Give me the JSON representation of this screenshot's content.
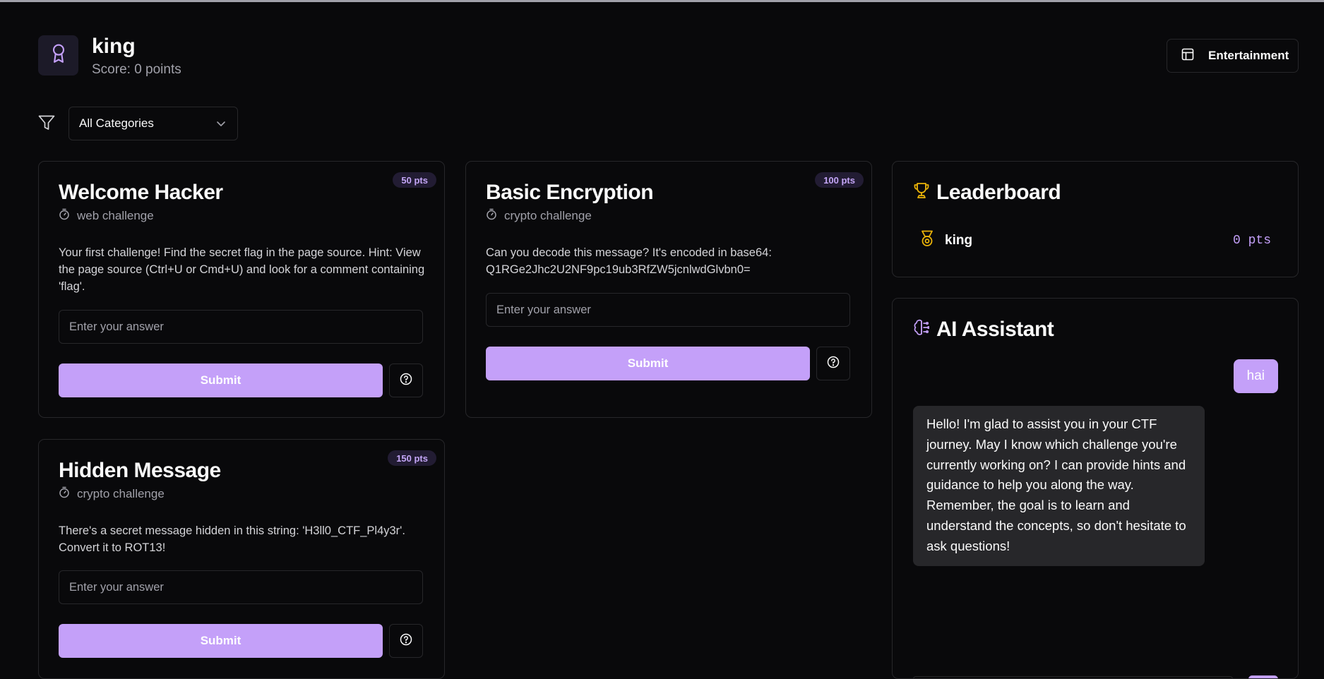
{
  "header": {
    "user_name": "king",
    "score_text": "Score: 0 points",
    "mode_button_label": "Entertainment"
  },
  "filter": {
    "selected": "All Categories"
  },
  "challenges": [
    {
      "title": "Welcome Hacker",
      "points": "50 pts",
      "category": "web challenge",
      "description": "Your first challenge! Find the secret flag in the page source. Hint: View the page source (Ctrl+U or Cmd+U) and look for a comment containing 'flag'.",
      "placeholder": "Enter your answer",
      "submit_label": "Submit"
    },
    {
      "title": "Basic Encryption",
      "points": "100 pts",
      "category": "crypto challenge",
      "description": "Can you decode this message? It's encoded in base64: Q1RGe2Jhc2U2NF9pc19ub3RfZW5jcnlwdGlvbn0=",
      "placeholder": "Enter your answer",
      "submit_label": "Submit"
    },
    {
      "title": "Hidden Message",
      "points": "150 pts",
      "category": "crypto challenge",
      "description": "There's a secret message hidden in this string: 'H3ll0_CTF_Pl4y3r'. Convert it to ROT13!",
      "placeholder": "Enter your answer",
      "submit_label": "Submit"
    }
  ],
  "leaderboard": {
    "title": "Leaderboard",
    "entries": [
      {
        "name": "king",
        "points": "0 pts"
      }
    ]
  },
  "assistant": {
    "title": "AI Assistant",
    "messages": [
      {
        "role": "user",
        "text": "hai"
      },
      {
        "role": "assistant",
        "text": "Hello! I'm glad to assist you in your CTF journey. May I know which challenge you're currently working on? I can provide hints and guidance to help you along the way. Remember, the goal is to learn and understand the concepts, so don't hesitate to ask questions!"
      }
    ]
  },
  "colors": {
    "background": "#09090b",
    "accent": "#c4a0f9",
    "border": "#27272a",
    "trophy": "#eab308"
  },
  "icons": [
    "award-icon",
    "layout-icon",
    "filter-icon",
    "chevron-down-icon",
    "timer-icon",
    "help-circle-icon",
    "trophy-icon",
    "medal-icon",
    "brain-icon"
  ]
}
